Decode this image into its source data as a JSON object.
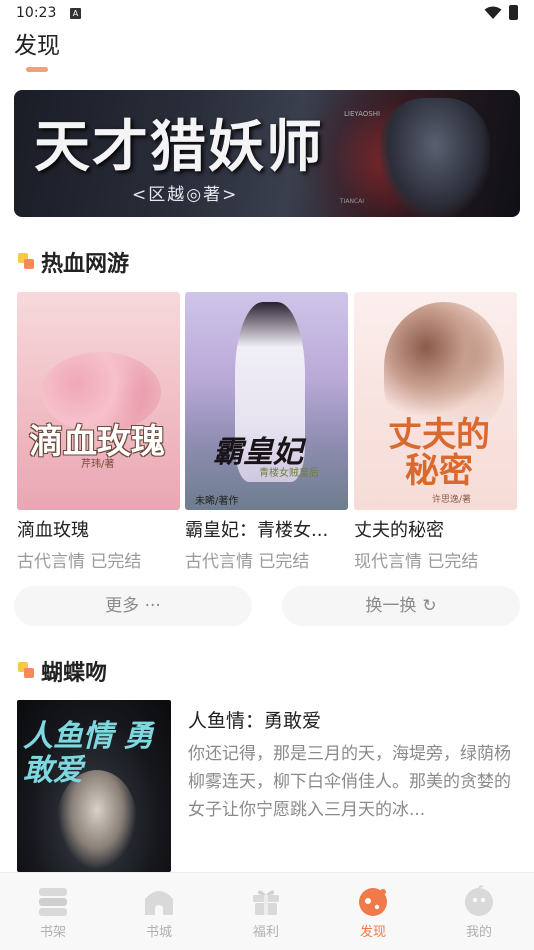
{
  "status_bar": {
    "time": "10:23",
    "notif_letter": "A"
  },
  "header": {
    "title": "发现"
  },
  "banner": {
    "title": "天才猎妖师",
    "author": "<区越◎著>",
    "latin_line1": "TIANCAI",
    "latin_line2": "LIEYAOSHI"
  },
  "section1": {
    "title": "热血网游",
    "books": [
      {
        "title": "滴血玫瑰",
        "meta": "古代言情 已完结",
        "cover_text": "滴血玫瑰",
        "cover_author": "芹玮/著"
      },
      {
        "title": "霸皇妃：青楼女...",
        "meta": "古代言情 已完结",
        "cover_text": "霸皇妃",
        "cover_sub": "青楼女贼皇后",
        "cover_author": "未晞/著作"
      },
      {
        "title": "丈夫的秘密",
        "meta": "现代言情 已完结",
        "cover_text": "丈夫的秘密",
        "cover_author": "许思逸/著"
      }
    ],
    "more_label": "更多 ···",
    "refresh_label": "换一换",
    "refresh_icon": "↻"
  },
  "section2": {
    "title": "蝴蝶吻",
    "book": {
      "title": "人鱼情：勇敢爱",
      "desc": "你还记得，那是三月的天，海堤旁，绿荫杨柳雾连天，柳下白伞俏佳人。那美的贪婪的女子让你宁愿跳入三月天的冰...",
      "cover_text": "人鱼情 勇敢爱"
    }
  },
  "bottom_nav": [
    {
      "label": "书架",
      "icon": "bookshelf-icon"
    },
    {
      "label": "书城",
      "icon": "bookstore-icon"
    },
    {
      "label": "福利",
      "icon": "gift-icon"
    },
    {
      "label": "发现",
      "icon": "discover-icon",
      "active": true
    },
    {
      "label": "我的",
      "icon": "profile-icon"
    }
  ],
  "colors": {
    "accent": "#f07a4a",
    "inactive": "#b0b0b0"
  }
}
